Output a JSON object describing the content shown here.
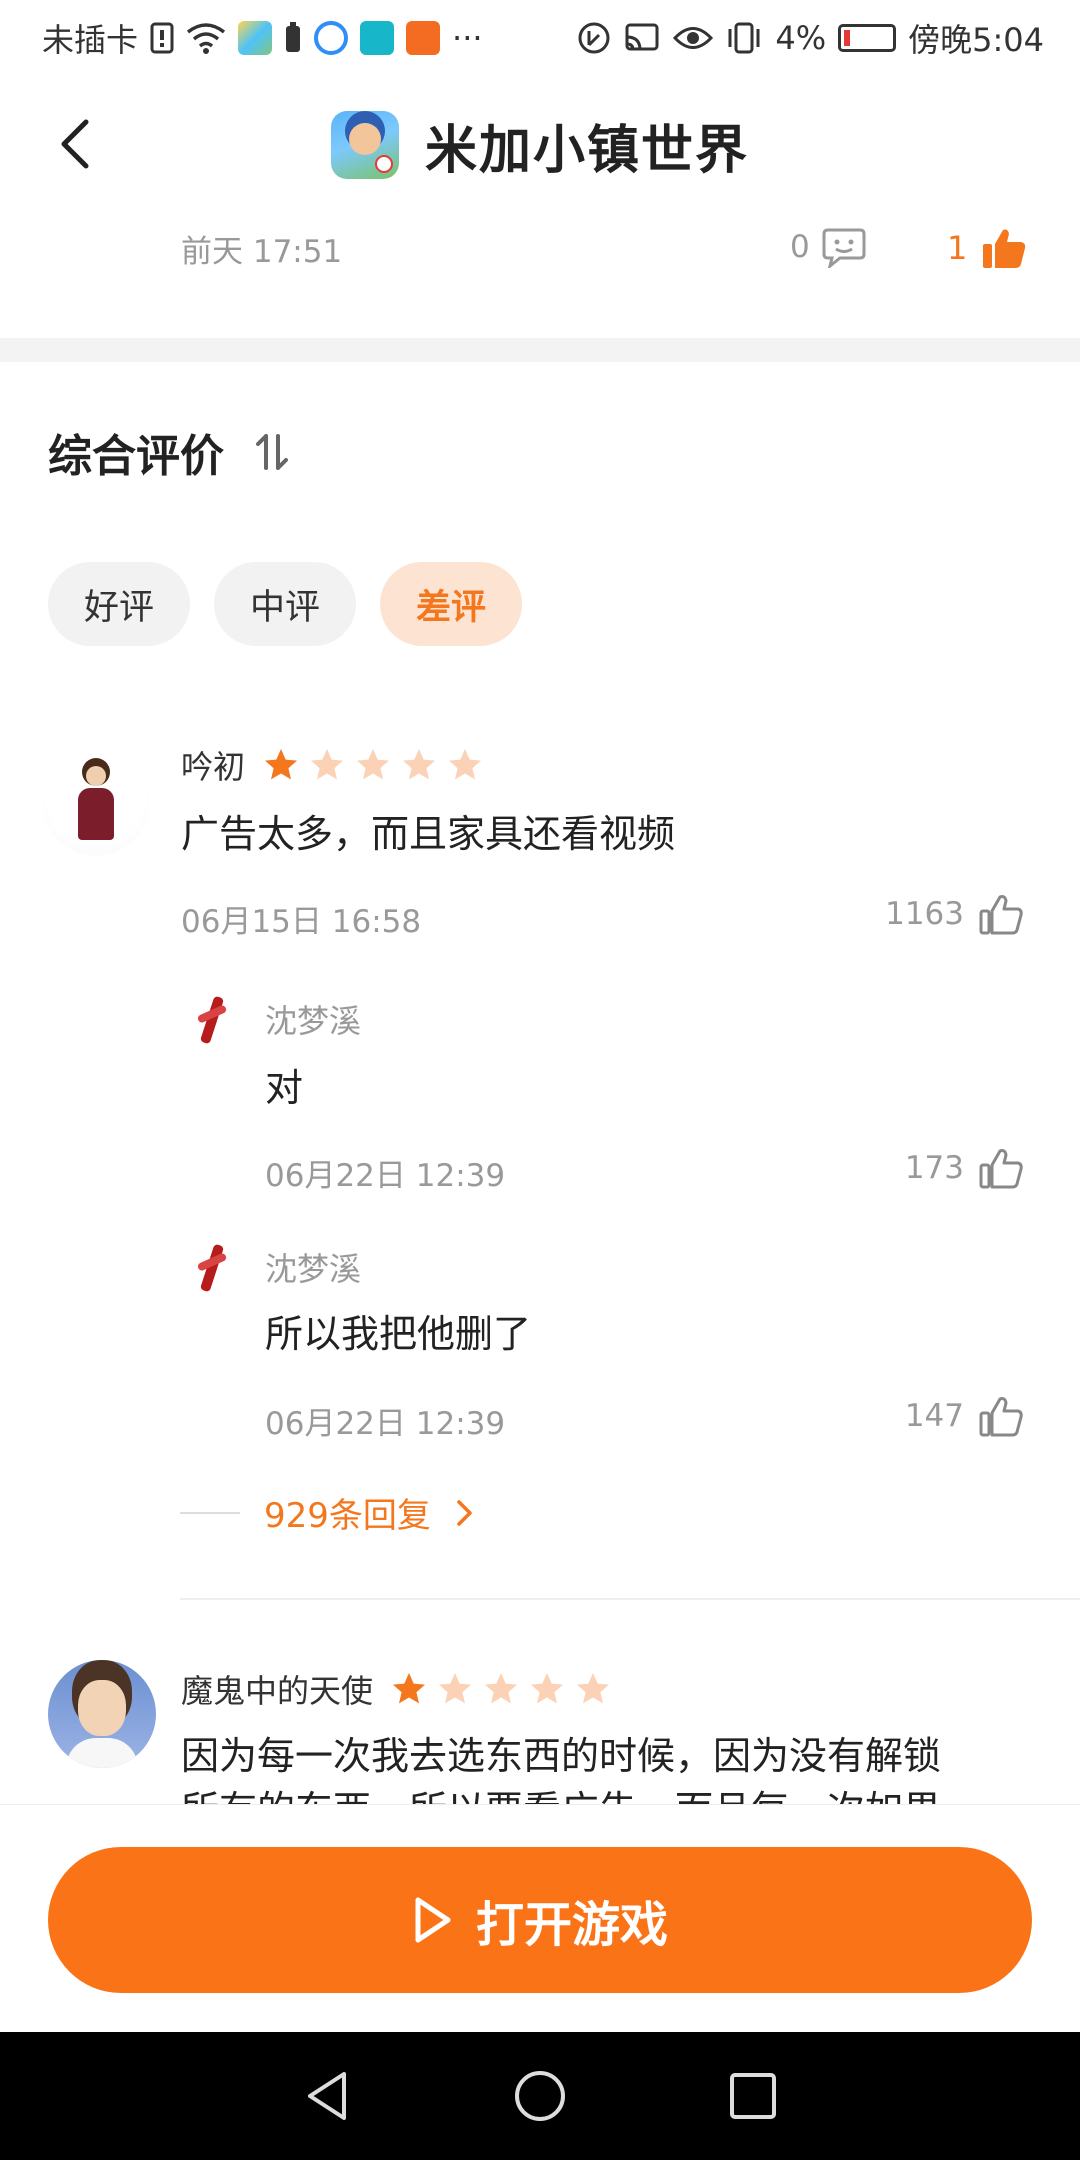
{
  "status_bar": {
    "carrier": "未插卡",
    "more": "···",
    "battery_pct": "4%",
    "time": "傍晚5:04"
  },
  "header": {
    "title": "米加小镇世界"
  },
  "previous_comment": {
    "time": "前天 17:51",
    "reply_count": "0",
    "like_count": "1"
  },
  "section": {
    "title": "综合评价"
  },
  "filters": [
    "好评",
    "中评",
    "差评"
  ],
  "colors": {
    "accent": "#fb7317",
    "star_filled": "#f4761d",
    "star_empty": "#fbd2b5"
  },
  "reviews": [
    {
      "user": "吟初",
      "rating": 1,
      "text": "广告太多，而且家具还看视频",
      "time": "06月15日 16:58",
      "likes": "1163",
      "replies": [
        {
          "user": "沈梦溪",
          "text": "对",
          "time": "06月22日 12:39",
          "likes": "173"
        },
        {
          "user": "沈梦溪",
          "text": "所以我把他删了",
          "time": "06月22日 12:39",
          "likes": "147"
        }
      ],
      "more_replies": "929条回复"
    },
    {
      "user": "魔鬼中的天使",
      "rating": 1,
      "text": "因为每一次我去选东西的时候，因为没有解锁",
      "text_line2": "所有的东西，所以要看广告，而且每一次如果"
    }
  ],
  "bottom": {
    "open_button": "打开游戏"
  }
}
